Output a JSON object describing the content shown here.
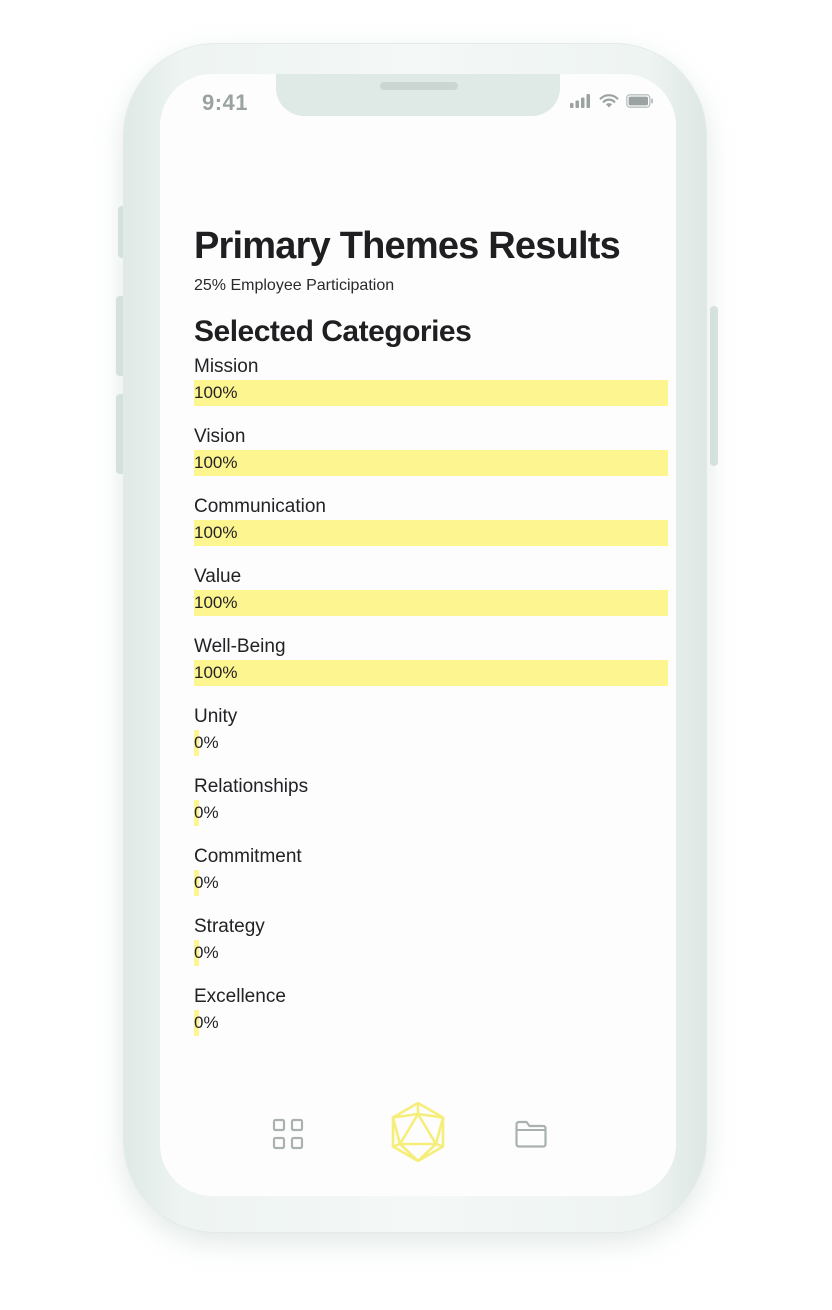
{
  "status_bar": {
    "time": "9:41",
    "signal_icon": "cellular-signal-icon",
    "wifi_icon": "wifi-icon",
    "battery_icon": "battery-icon"
  },
  "page": {
    "title": "Primary Themes Results",
    "participation": "25% Employee Participation",
    "section_title": "Selected Categories"
  },
  "categories": [
    {
      "label": "Mission",
      "value_text": "100%",
      "value": 100
    },
    {
      "label": "Vision",
      "value_text": "100%",
      "value": 100
    },
    {
      "label": "Communication",
      "value_text": "100%",
      "value": 100
    },
    {
      "label": "Value",
      "value_text": "100%",
      "value": 100
    },
    {
      "label": "Well-Being",
      "value_text": "100%",
      "value": 100
    },
    {
      "label": "Unity",
      "value_text": "0%",
      "value": 0
    },
    {
      "label": "Relationships",
      "value_text": "0%",
      "value": 0
    },
    {
      "label": "Commitment",
      "value_text": "0%",
      "value": 0
    },
    {
      "label": "Strategy",
      "value_text": "0%",
      "value": 0
    },
    {
      "label": "Excellence",
      "value_text": "0%",
      "value": 0
    }
  ],
  "tabbar": {
    "items": [
      {
        "icon": "grid-icon",
        "active": false
      },
      {
        "icon": "icosahedron-icon",
        "active": true
      },
      {
        "icon": "folder-icon",
        "active": false
      }
    ]
  },
  "colors": {
    "bar_fill": "#fdf590",
    "accent_icon": "#f6ee7a",
    "inactive_icon": "#a9b2af",
    "phone_frame": "#e9f1ee"
  }
}
